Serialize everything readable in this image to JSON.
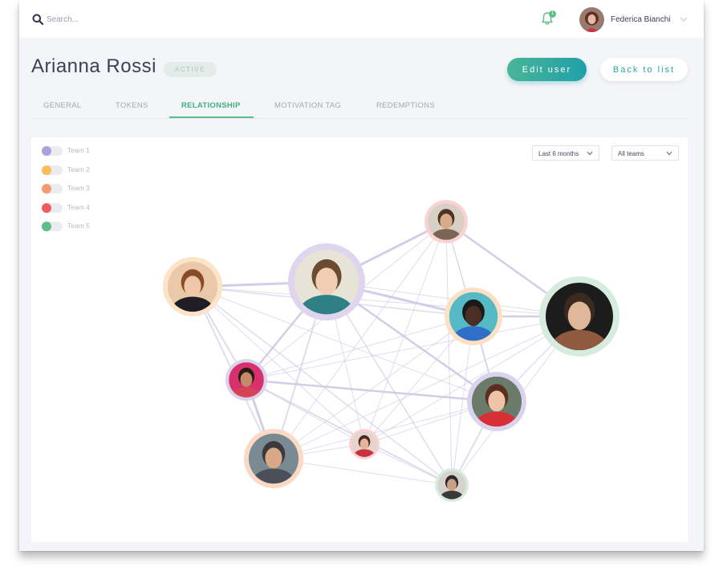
{
  "header": {
    "search_placeholder": "Search...",
    "notification_count": "1",
    "user_name": "Federica Bianchi"
  },
  "profile": {
    "name": "Arianna Rossi",
    "status": "ACTIVE",
    "edit_label": "Edit user",
    "back_label": "Back to list"
  },
  "tabs": [
    {
      "label": "GENERAL",
      "active": false
    },
    {
      "label": "TOKENS",
      "active": false
    },
    {
      "label": "RELATIONSHIP",
      "active": true
    },
    {
      "label": "MOTIVATION TAG",
      "active": false
    },
    {
      "label": "REDEMPTIONS",
      "active": false
    }
  ],
  "legend": [
    {
      "label": "Team 1",
      "color": "#a8a4d8"
    },
    {
      "label": "Team 2",
      "color": "#f8bd5c"
    },
    {
      "label": "Team 3",
      "color": "#f59874"
    },
    {
      "label": "Team 4",
      "color": "#ec5d62"
    },
    {
      "label": "Team 5",
      "color": "#5cbf8a"
    }
  ],
  "filters": {
    "period": "Last 6 months",
    "team": "All teams"
  },
  "colors": {
    "accent_green": "#5cbf8a",
    "accent_teal": "#1fa0a8",
    "title": "#3b4156",
    "edge": "#c9c7e0"
  }
}
